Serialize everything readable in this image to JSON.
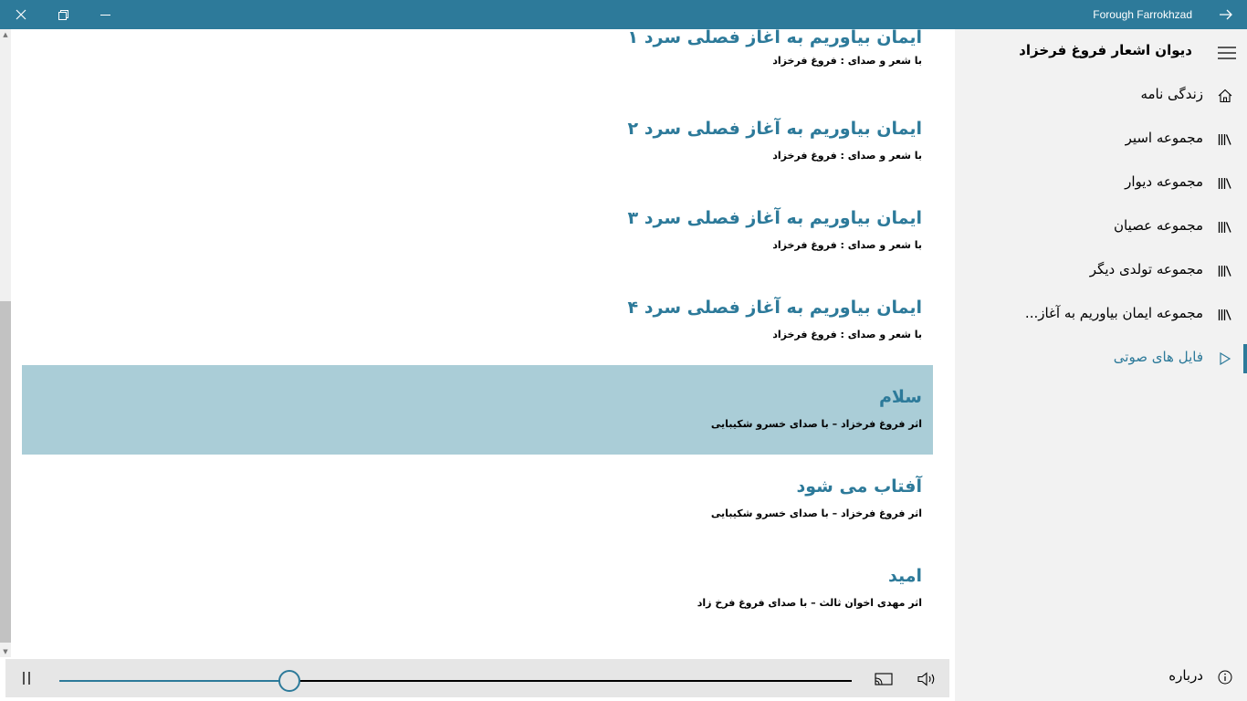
{
  "window": {
    "title": "Forough Farrokhzad"
  },
  "sidebar": {
    "title": "دیوان اشعار فروغ  فرخزاد",
    "items": [
      {
        "label": "زندگی نامه",
        "icon": "home-icon"
      },
      {
        "label": "مجموعه اسیر",
        "icon": "library-icon"
      },
      {
        "label": "مجموعه دیوار",
        "icon": "library-icon"
      },
      {
        "label": "مجموعه عصیان",
        "icon": "library-icon"
      },
      {
        "label": "مجموعه تولدی دیگر",
        "icon": "library-icon"
      },
      {
        "label": "مجموعه ایمان بیاوریم به آغاز...",
        "icon": "library-icon"
      },
      {
        "label": "فایل های صوتی",
        "icon": "play-icon",
        "active": true
      }
    ],
    "about_label": "درباره"
  },
  "list": {
    "items": [
      {
        "title": "ایمان بیاوریم به آغاز فصلی سرد ۱",
        "subtitle": "با شعر و صدای : فروغ فرخزاد"
      },
      {
        "title": "ایمان بیاوریم به آغاز فصلی سرد ۲",
        "subtitle": "با شعر و صدای : فروغ فرخزاد"
      },
      {
        "title": "ایمان بیاوریم به آغاز فصلی سرد ۳",
        "subtitle": "با شعر و صدای : فروغ فرخزاد"
      },
      {
        "title": "ایمان بیاوریم به آغاز فصلی سرد ۴",
        "subtitle": "با شعر و صدای : فروغ فرخزاد"
      },
      {
        "title": "سلام",
        "subtitle": "اثر فروغ فرخزاد – با صدای خسرو شکیبایی",
        "selected": true
      },
      {
        "title": "آفتاب می شود",
        "subtitle": "اثر فروغ فرخزاد – با صدای خسرو شکیبایی"
      },
      {
        "title": "امید",
        "subtitle": "اثر مهدی اخوان ثالث – با صدای فروغ فرخ زاد"
      }
    ]
  },
  "player": {
    "progress_fraction": 0.29
  },
  "colors": {
    "accent": "#2d7a9a",
    "selected_row": "#aacdd7",
    "sidebar_bg": "#f2f2f2",
    "player_bg": "#e6e6e6"
  }
}
